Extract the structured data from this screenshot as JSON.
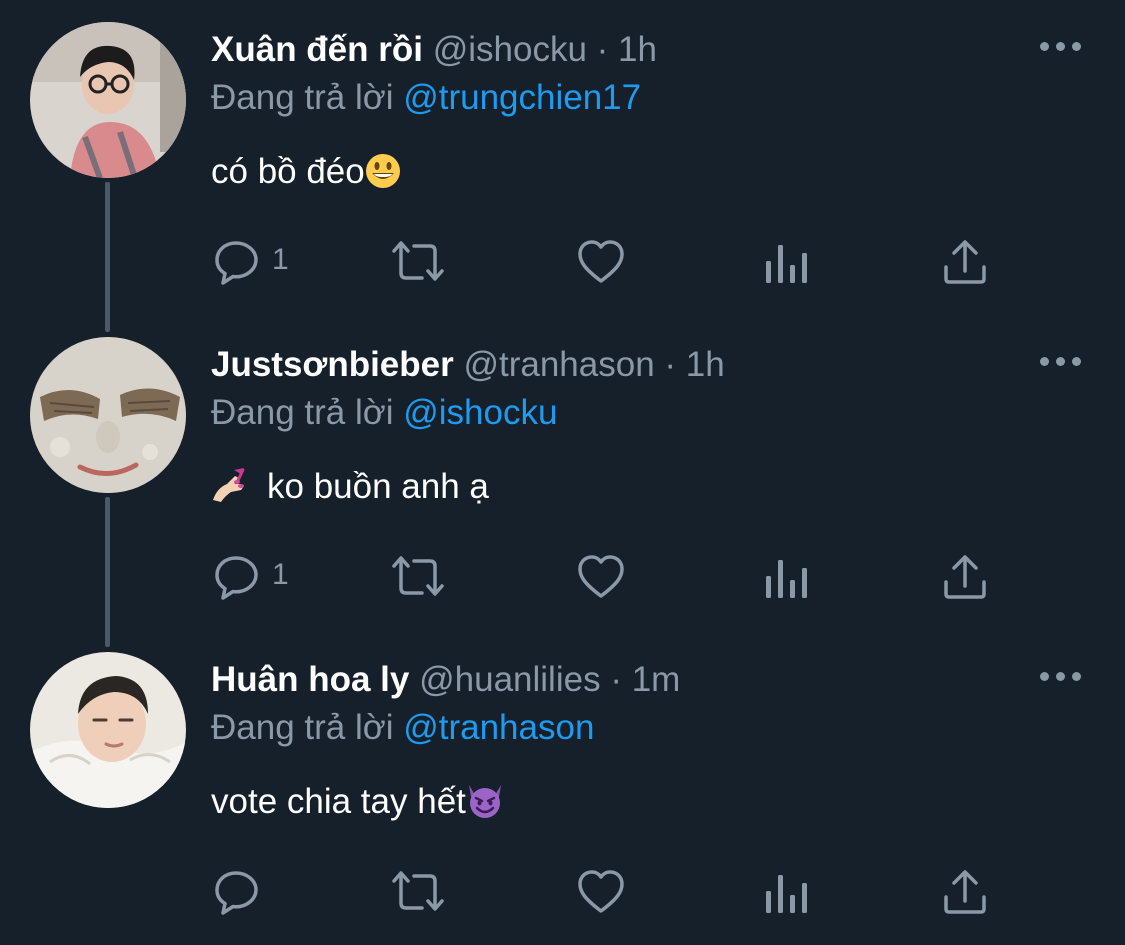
{
  "tweets": [
    {
      "name": "Xuân đến rồi",
      "handle": "@ishocku",
      "separator": "·",
      "time": "1h",
      "replying_label": "Đang trả lời",
      "replying_to": "@trungchien17",
      "text": "có bồ đéo",
      "emoji": "grinning-face",
      "reply_count": "1",
      "avatar": "avatar-glasses-person"
    },
    {
      "name": "Justsơnbieber",
      "handle": "@tranhason",
      "separator": "·",
      "time": "1h",
      "replying_label": "Đang trả lời",
      "replying_to": "@ishocku",
      "text": "ko buồn anh ạ",
      "emoji": "nail-polish",
      "reply_count": "1",
      "avatar": "avatar-face-mask"
    },
    {
      "name": "Huân hoa ly",
      "handle": "@huanlilies",
      "separator": "·",
      "time": "1m",
      "replying_label": "Đang trả lời",
      "replying_to": "@tranhason",
      "text": "vote chia tay hết",
      "emoji": "smiling-face-with-horns",
      "reply_count": "",
      "avatar": "avatar-lying-person"
    }
  ],
  "colors": {
    "background": "#15202b",
    "text": "#ffffff",
    "muted": "#8b98a5",
    "accent": "#1d9bf0",
    "thread_line": "#4a5968"
  },
  "icons": [
    "reply-icon",
    "retweet-icon",
    "like-icon",
    "views-icon",
    "share-icon",
    "more-icon"
  ]
}
